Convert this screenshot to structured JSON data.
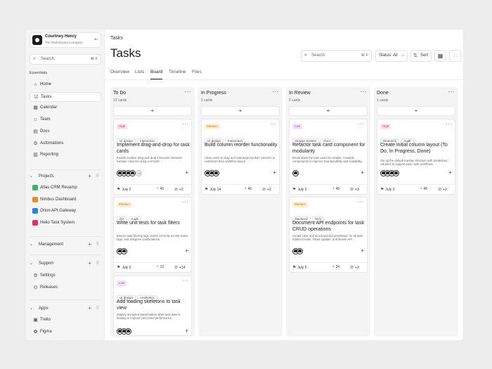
{
  "account": {
    "name": "Courtney Henry",
    "company": "The Walt Disney Company",
    "collapse_icon": "sidebar-collapse-icon"
  },
  "sidebar": {
    "search_placeholder": "Search",
    "search_shortcut": "⌘ F",
    "essentials_label": "Essentials",
    "items": [
      {
        "label": "Home",
        "icon": "home-icon",
        "glyph": "⌂"
      },
      {
        "label": "Tasks",
        "icon": "tasks-icon",
        "glyph": "☑"
      },
      {
        "label": "Calendar",
        "icon": "calendar-icon",
        "glyph": "▦"
      },
      {
        "label": "Team",
        "icon": "team-icon",
        "glyph": "☺"
      },
      {
        "label": "Docs",
        "icon": "docs-icon",
        "glyph": "▤"
      },
      {
        "label": "Automations",
        "icon": "automations-icon",
        "glyph": "⚙"
      },
      {
        "label": "Reporting",
        "icon": "reporting-icon",
        "glyph": "▥"
      }
    ],
    "active_item": "Tasks",
    "projects_label": "Projects",
    "projects": [
      {
        "label": "Atlas CRM Revamp",
        "color": "#3db36b"
      },
      {
        "label": "Nimbus Dashboard",
        "color": "#f08a24"
      },
      {
        "label": "Orion API Gateway",
        "color": "#2f7fe0"
      },
      {
        "label": "Helio Task System",
        "color": "#e0306a"
      }
    ],
    "management_label": "Management",
    "support_label": "Support",
    "support_items": [
      {
        "label": "Settings",
        "icon": "settings-icon",
        "glyph": "⚙"
      },
      {
        "label": "Releases",
        "icon": "releases-icon",
        "glyph": "⌬"
      }
    ],
    "apps_label": "Apps",
    "apps": [
      {
        "label": "Trello",
        "icon": "trello-icon",
        "glyph": "▣"
      },
      {
        "label": "Figma",
        "icon": "figma-icon",
        "glyph": "✿"
      }
    ]
  },
  "header": {
    "breadcrumb": "Tasks",
    "title": "Tasks",
    "search_placeholder": "Search",
    "search_shortcut": "⌘ F",
    "status_filter": "Status: All",
    "sort_label": "Sort"
  },
  "tabs": [
    "Overview",
    "Lists",
    "Board",
    "Timeline",
    "Files"
  ],
  "active_tab": "Board",
  "columns": [
    {
      "title": "To Do",
      "count": "12 cards",
      "cards": [
        {
          "priority": "High",
          "tags": [
            "UI design",
            "Interaction"
          ],
          "title": "Implement drag-and-drop for task cards",
          "desc": "Enable intuitive drag-and-drop interaction between Kanban columns using a smooth",
          "extra_avatars": "+3",
          "date": "July 2",
          "progress": "45",
          "attachments": "+2"
        },
        {
          "priority": "Medium",
          "tags": [
            "QA",
            "Audit"
          ],
          "title": "Write unit tests for task filters",
          "desc": "Ensure task filtering logic works correctly across status, tags, and assignee combinations.",
          "extra_avatars": "",
          "date": "July 5",
          "progress": "12",
          "attachments": "+14"
        },
        {
          "priority": "Low",
          "tags": [
            "UI design",
            "Aesthetics"
          ],
          "title": "Add loading skeletons to task view",
          "desc": "Display animated placeholders while task data is loading to improve perceived performance.",
          "extra_avatars": "",
          "date": "",
          "progress": "",
          "attachments": ""
        }
      ]
    },
    {
      "title": "In Progress",
      "count": "1 cards",
      "cards": [
        {
          "priority": "Medium",
          "tags": [
            "UI design",
            "Interaction"
          ],
          "title": "Build column reorder functionality",
          "desc": "Allow users to drag and rearrange Kanban columns to customize their workflow layout",
          "extra_avatars": "",
          "date": "July 14",
          "progress": "45",
          "attachments": "+2"
        }
      ]
    },
    {
      "title": "In Review",
      "count": "2 cards",
      "cards": [
        {
          "priority": "Low",
          "tags": [
            "Design System",
            "Docs"
          ],
          "title": "Refactor task card component for modularity",
          "desc": "Break down the task card into smaller, reusable components to improve maintainability and scalability.",
          "extra_avatars": "",
          "date": "July 2",
          "progress": "45",
          "attachments": "+3"
        },
        {
          "priority": "Medium",
          "tags": [
            "Backend",
            "Tech"
          ],
          "title": "Document API endpoints for task CRUD operations",
          "desc": "Create clear and structured documentation for all task-related Create, Read, Update, and Delete API",
          "extra_avatars": "",
          "date": "July 5",
          "progress": "34",
          "attachments": "+2"
        }
      ]
    },
    {
      "title": "Done",
      "count": "1 cards",
      "cards": [
        {
          "priority": "High",
          "tags": [
            "Research",
            "Audit"
          ],
          "title": "Create initial column layout (To Do, In Progress, Done)",
          "desc": "Set up the default Kanban structure with predefined columns to support basic task workflows.",
          "extra_avatars": "",
          "date": "July 2",
          "progress": "45",
          "attachments": "+2"
        }
      ]
    }
  ]
}
